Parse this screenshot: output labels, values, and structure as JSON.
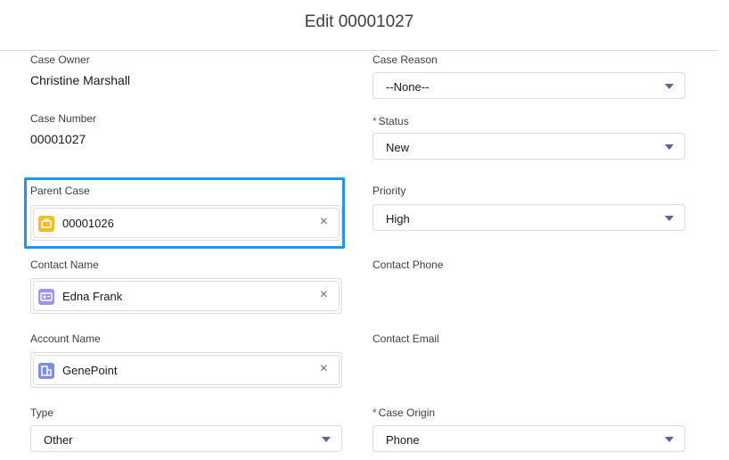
{
  "header": {
    "title": "Edit 00001027"
  },
  "fields": {
    "case_owner": {
      "label": "Case Owner",
      "value": "Christine Marshall"
    },
    "case_number": {
      "label": "Case Number",
      "value": "00001027"
    },
    "parent_case": {
      "label": "Parent Case",
      "value": "00001026",
      "icon": "case-icon",
      "icon_color": "#f4bc25"
    },
    "contact_name": {
      "label": "Contact Name",
      "value": "Edna Frank",
      "icon": "contact-icon",
      "icon_color": "#a094ed"
    },
    "account_name": {
      "label": "Account Name",
      "value": "GenePoint",
      "icon": "account-icon",
      "icon_color": "#7f8de1"
    },
    "type": {
      "label": "Type",
      "value": "Other"
    },
    "case_reason": {
      "label": "Case Reason",
      "value": "--None--"
    },
    "status": {
      "label": "Status",
      "required": true,
      "value": "New"
    },
    "priority": {
      "label": "Priority",
      "value": "High"
    },
    "contact_phone": {
      "label": "Contact Phone"
    },
    "contact_email": {
      "label": "Contact Email"
    },
    "case_origin": {
      "label": "Case Origin",
      "required": true,
      "value": "Phone"
    }
  },
  "glyphs": {
    "required_marker": "*",
    "clear": "×"
  },
  "colors": {
    "focus_highlight": "#1b96ff",
    "required": "#c23934"
  }
}
